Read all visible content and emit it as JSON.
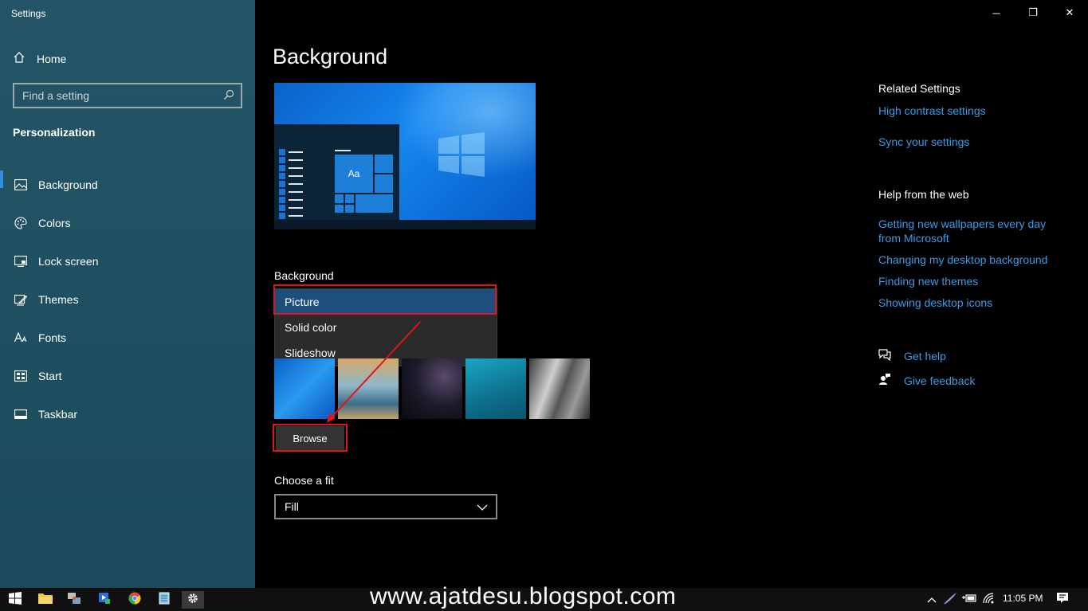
{
  "window": {
    "title": "Settings",
    "minimize": "─",
    "restore": "❐",
    "close": "✕"
  },
  "sidebar": {
    "home_label": "Home",
    "search_placeholder": "Find a setting",
    "section_title": "Personalization",
    "items": [
      {
        "label": "Background",
        "icon": "picture-icon",
        "active": true
      },
      {
        "label": "Colors",
        "icon": "palette-icon",
        "active": false
      },
      {
        "label": "Lock screen",
        "icon": "lock-screen-icon",
        "active": false
      },
      {
        "label": "Themes",
        "icon": "themes-icon",
        "active": false
      },
      {
        "label": "Fonts",
        "icon": "fonts-icon",
        "active": false
      },
      {
        "label": "Start",
        "icon": "start-icon",
        "active": false
      },
      {
        "label": "Taskbar",
        "icon": "taskbar-icon",
        "active": false
      }
    ]
  },
  "main": {
    "page_title": "Background",
    "preview_tile_text": "Aa",
    "background_label": "Background",
    "background_options": [
      "Picture",
      "Solid color",
      "Slideshow"
    ],
    "selected_background": "Picture",
    "browse_label": "Browse",
    "fit_label": "Choose a fit",
    "fit_value": "Fill"
  },
  "related": {
    "heading": "Related Settings",
    "links": [
      "High contrast settings",
      "Sync your settings"
    ]
  },
  "help_web": {
    "heading": "Help from the web",
    "links": [
      "Getting new wallpapers every day from Microsoft",
      "Changing my desktop background",
      "Finding new themes",
      "Showing desktop icons"
    ]
  },
  "support": {
    "get_help": "Get help",
    "give_feedback": "Give feedback"
  },
  "taskbar": {
    "watermark": "www.ajatdesu.blogspot.com",
    "time": "11:05 PM"
  },
  "colors": {
    "accent": "#3b9ae8",
    "highlight_red": "#e0141a",
    "sidebar_bg": "#1f4e5e"
  }
}
